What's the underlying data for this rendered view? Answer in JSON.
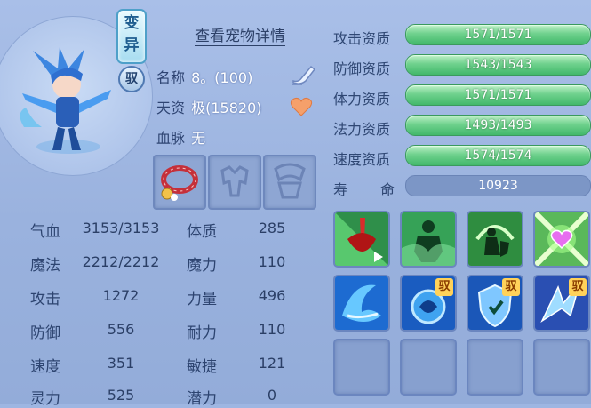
{
  "pet": {
    "transform_tag": "变异",
    "yu_tag": "驭",
    "detail_link": "查看宠物详情",
    "name_label": "名称",
    "name_value": "8。(100)",
    "aptitude_label": "天资",
    "aptitude_value": "极(15820)",
    "bloodline_label": "血脉",
    "bloodline_value": "无"
  },
  "equipment": [
    {
      "icon": "red-beaded-collar-icon"
    },
    {
      "icon": "empty-armor-slot-icon"
    },
    {
      "icon": "empty-accessory-slot-icon"
    }
  ],
  "stats": {
    "hp_label": "气血",
    "hp_value": "3153/3153",
    "mp_label": "魔法",
    "mp_value": "2212/2212",
    "attack_label": "攻击",
    "attack_value": "1272",
    "defense_label": "防御",
    "defense_value": "556",
    "speed_label": "速度",
    "speed_value": "351",
    "spirit_label": "灵力",
    "spirit_value": "525",
    "con_label": "体质",
    "con_value": "285",
    "magic_label": "魔力",
    "magic_value": "110",
    "str_label": "力量",
    "str_value": "496",
    "end_label": "耐力",
    "end_value": "110",
    "agi_label": "敏捷",
    "agi_value": "121",
    "potential_label": "潜力",
    "potential_value": "0"
  },
  "aptitudes": [
    {
      "label": "攻击资质",
      "value": "1571/1571",
      "fill": 1.0
    },
    {
      "label": "防御资质",
      "value": "1543/1543",
      "fill": 1.0
    },
    {
      "label": "体力资质",
      "value": "1571/1571",
      "fill": 1.0
    },
    {
      "label": "法力资质",
      "value": "1493/1493",
      "fill": 1.0
    },
    {
      "label": "速度资质",
      "value": "1574/1574",
      "fill": 1.0
    }
  ],
  "lifespan": {
    "label_a": "寿",
    "label_b": "命",
    "value": "10923"
  },
  "skills": [
    {
      "icon": "blood-drain-skill-icon"
    },
    {
      "icon": "shadow-clone-skill-icon"
    },
    {
      "icon": "shield-warrior-skill-icon"
    },
    {
      "icon": "heart-aura-skill-icon"
    },
    {
      "icon": "water-wave-skill-icon"
    },
    {
      "icon": "water-orb-skill-icon",
      "badge": "驭"
    },
    {
      "icon": "shield-guard-skill-icon",
      "badge": "驭"
    },
    {
      "icon": "ice-shard-skill-icon",
      "badge": "驭"
    }
  ],
  "colors": {
    "bar_green": "#5ccb7e",
    "panel_blue": "#9eb6e2",
    "text_dark": "#2d4470"
  }
}
